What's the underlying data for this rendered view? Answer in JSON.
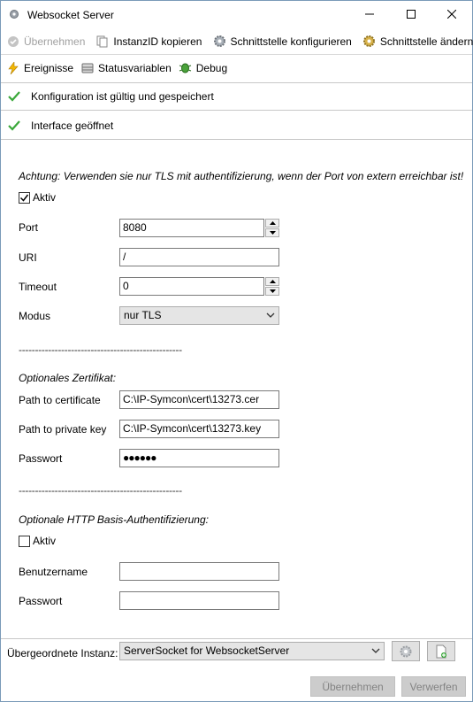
{
  "window": {
    "title": "Websocket Server"
  },
  "toolbar1": {
    "apply_label": "Übernehmen",
    "copy_id_label": "InstanzID kopieren",
    "configure_interface_label": "Schnittstelle konfigurieren",
    "change_interface_label": "Schnittstelle ändern"
  },
  "toolbar2": {
    "events_label": "Ereignisse",
    "status_vars_label": "Statusvariablen",
    "debug_label": "Debug"
  },
  "status": {
    "config_valid": "Konfiguration ist gültig und gespeichert",
    "interface_open": "Interface geöffnet"
  },
  "form": {
    "warning": "Achtung: Verwenden sie nur TLS mit authentifizierung, wenn der Port von extern erreichbar ist!",
    "active1_label": "Aktiv",
    "active1_checked": true,
    "port_label": "Port",
    "port_value": "8080",
    "uri_label": "URI",
    "uri_value": "/",
    "timeout_label": "Timeout",
    "timeout_value": "0",
    "mode_label": "Modus",
    "mode_value": "nur TLS",
    "separator": "--------------------------------------------------",
    "cert_heading": "Optionales Zertifikat:",
    "cert_path_label": "Path to certificate",
    "cert_path_value": "C:\\IP-Symcon\\cert\\13273.cer",
    "key_path_label": "Path to private key",
    "key_path_value": "C:\\IP-Symcon\\cert\\13273.key",
    "password_label": "Passwort",
    "password_value": "●●●●●●",
    "auth_heading": "Optionale HTTP Basis-Authentifizierung:",
    "active2_label": "Aktiv",
    "active2_checked": false,
    "username_label": "Benutzername",
    "username_value": "",
    "password2_label": "Passwort",
    "password2_value": ""
  },
  "parent": {
    "label": "Übergeordnete Instanz:",
    "value": "ServerSocket for WebsocketServer"
  },
  "buttons": {
    "apply_label": "Übernehmen",
    "discard_label": "Verwerfen"
  },
  "colors": {
    "check_green": "#3aa83a",
    "disabled_text": "#838383",
    "disabled_bg": "#cccccc"
  }
}
